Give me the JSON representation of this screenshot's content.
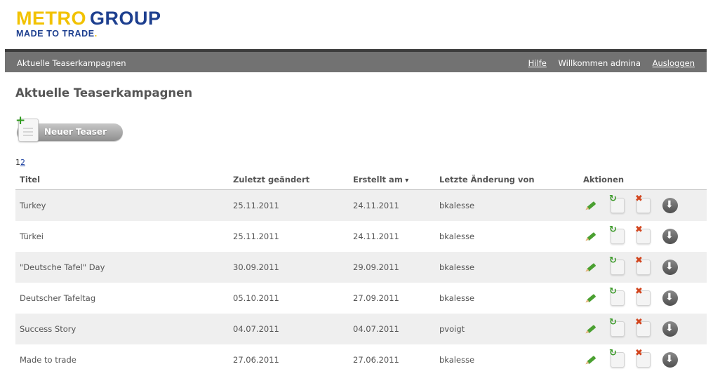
{
  "logo": {
    "word1": "METRO",
    "word2": "GROUP",
    "tagline": "MADE TO TRADE",
    "tagline_dot": "."
  },
  "topbar": {
    "crumb": "Aktuelle Teaserkampagnen",
    "help": "Hilfe",
    "welcome": "Willkommen admina",
    "logout": "Ausloggen"
  },
  "page": {
    "title": "Aktuelle Teaserkampagnen",
    "new_button": "Neuer Teaser"
  },
  "pager": {
    "p1": "1",
    "p2": "2"
  },
  "table": {
    "headers": {
      "titel": "Titel",
      "zuletzt": "Zuletzt geändert",
      "erstellt": "Erstellt am",
      "letzte": "Letzte Änderung von",
      "aktionen": "Aktionen"
    },
    "rows": [
      {
        "titel": "Turkey",
        "zuletzt": "25.11.2011",
        "erstellt": "24.11.2011",
        "von": "bkalesse"
      },
      {
        "titel": "Türkei",
        "zuletzt": "25.11.2011",
        "erstellt": "24.11.2011",
        "von": "bkalesse"
      },
      {
        "titel": "\"Deutsche Tafel\" Day",
        "zuletzt": "30.09.2011",
        "erstellt": "29.09.2011",
        "von": "bkalesse"
      },
      {
        "titel": "Deutscher Tafeltag",
        "zuletzt": "05.10.2011",
        "erstellt": "27.09.2011",
        "von": "bkalesse"
      },
      {
        "titel": "Success Story",
        "zuletzt": "04.07.2011",
        "erstellt": "04.07.2011",
        "von": "pvoigt"
      },
      {
        "titel": "Made to trade",
        "zuletzt": "27.06.2011",
        "erstellt": "27.06.2011",
        "von": "bkalesse"
      }
    ]
  },
  "icons": {
    "edit": "pencil-icon",
    "refresh": "refresh-icon",
    "delete": "delete-icon",
    "download": "download-icon"
  }
}
